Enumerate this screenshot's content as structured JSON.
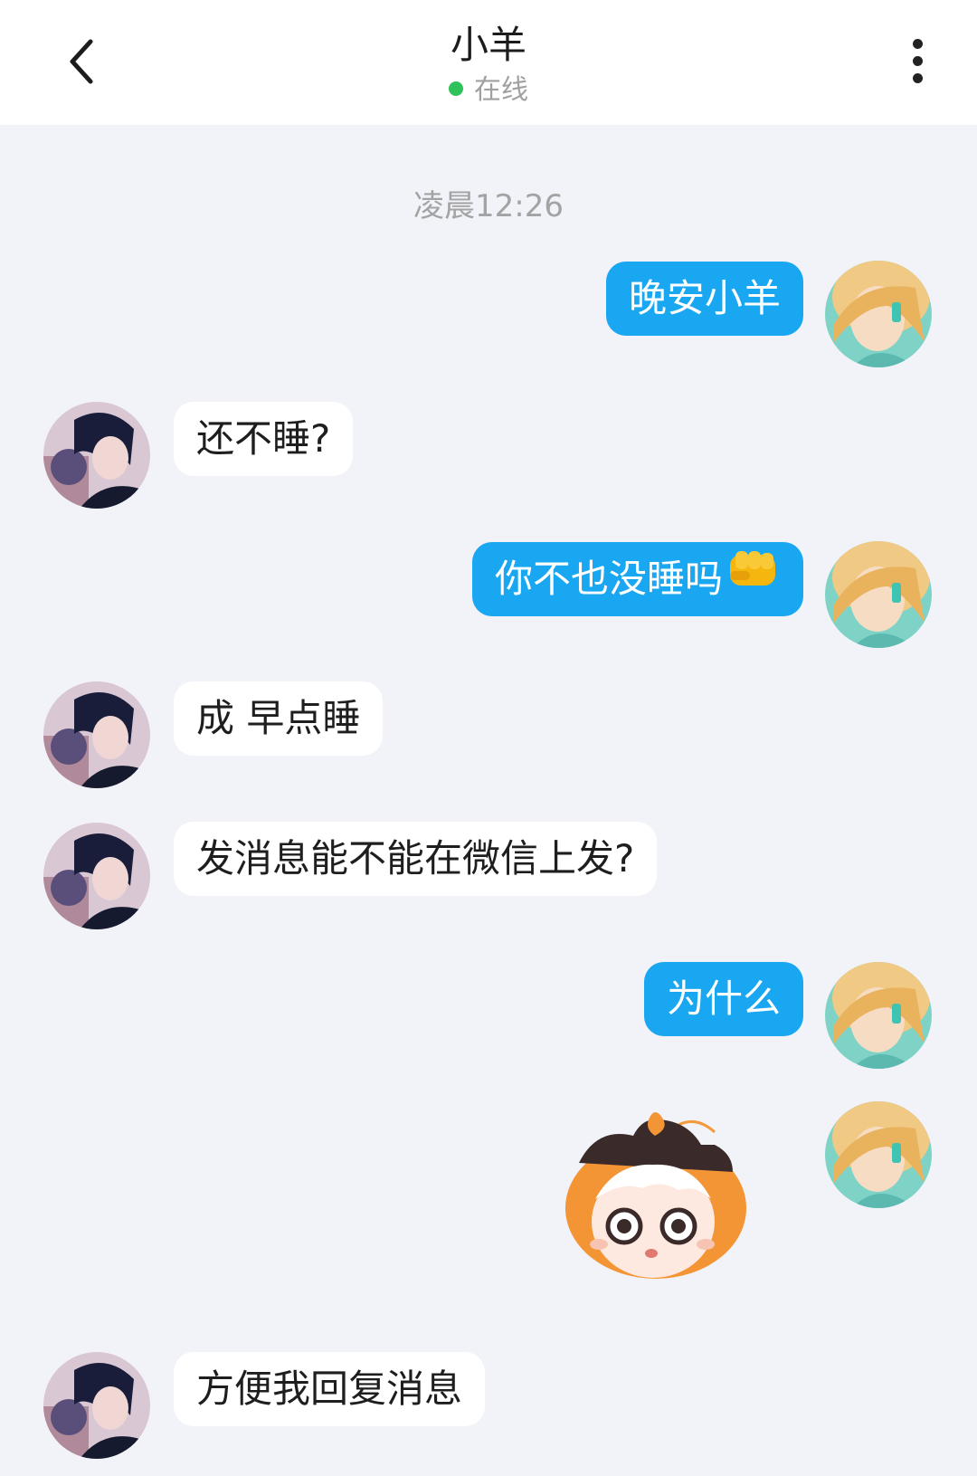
{
  "header": {
    "title": "小羊",
    "status": "在线",
    "status_color": "#2fc25b",
    "back_icon": "chevron-left-icon",
    "more_icon": "more-vertical-icon"
  },
  "chat": {
    "timestamp": "凌晨12:26",
    "messages": [
      {
        "side": "out",
        "type": "text",
        "text": "晚安小羊"
      },
      {
        "side": "in",
        "type": "text",
        "text": "还不睡?"
      },
      {
        "side": "out",
        "type": "text",
        "text": "你不也没睡吗",
        "emoji": "oncoming-fist-emoji"
      },
      {
        "side": "in",
        "type": "text",
        "text": "成 早点睡"
      },
      {
        "side": "in",
        "type": "text",
        "text": "发消息能不能在微信上发?"
      },
      {
        "side": "out",
        "type": "text",
        "text": "为什么"
      },
      {
        "side": "out",
        "type": "sticker",
        "sticker": "surprised-girl-sticker"
      },
      {
        "side": "in",
        "type": "text",
        "text": "方便我回复消息"
      }
    ]
  },
  "colors": {
    "outgoing_bubble": "#1aa7f2",
    "incoming_bubble": "#ffffff",
    "background": "#f2f3f8"
  }
}
